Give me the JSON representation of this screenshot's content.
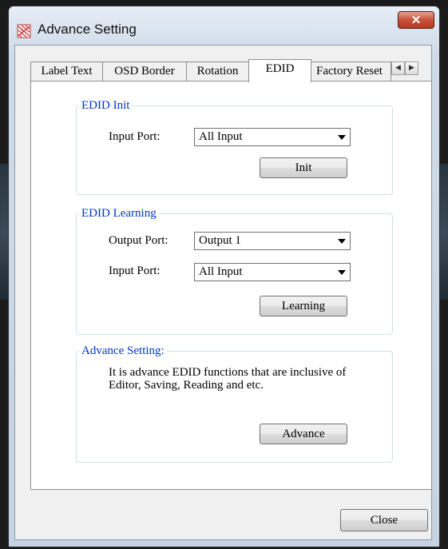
{
  "window": {
    "title": "Advance Setting",
    "close_glyph": "✕"
  },
  "tabs": [
    {
      "label": "Label Text"
    },
    {
      "label": "OSD Border"
    },
    {
      "label": "Rotation"
    },
    {
      "label": "EDID",
      "active": true
    },
    {
      "label": "Factory Reset"
    }
  ],
  "tab_scroll": {
    "left_glyph": "◀",
    "right_glyph": "▶"
  },
  "edid_init": {
    "group_label": "EDID Init",
    "input_port_label": "Input Port:",
    "input_port_value": "All Input",
    "init_button": "Init"
  },
  "edid_learning": {
    "group_label": "EDID Learning",
    "output_port_label": "Output Port:",
    "output_port_value": "Output 1",
    "input_port_label": "Input Port:",
    "input_port_value": "All Input",
    "learning_button": "Learning"
  },
  "advance_setting": {
    "group_label": "Advance Setting:",
    "description": "It is advance EDID functions that are inclusive of Editor, Saving, Reading and etc.",
    "advance_button": "Advance"
  },
  "footer": {
    "close_button": "Close"
  }
}
